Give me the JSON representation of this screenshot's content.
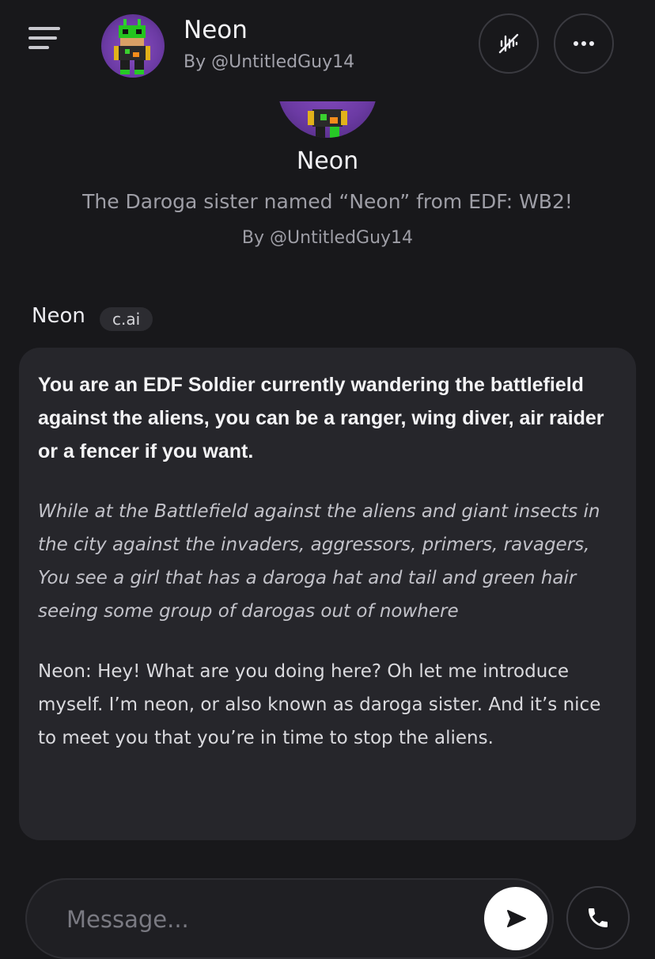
{
  "header": {
    "menu_icon": "hamburger-menu-icon",
    "title": "Neon",
    "subtitle": "By @UntitledGuy14",
    "voice_icon": "voice-muted-icon",
    "more_icon": "more-horizontal-icon"
  },
  "profile": {
    "name": "Neon",
    "description": "The Daroga sister named “Neon” from EDF: WB2!",
    "by": "By @UntitledGuy14"
  },
  "message": {
    "author": "Neon",
    "badge": "c.ai",
    "paragraphs": [
      "You are an EDF Soldier currently wandering the battlefield against the aliens, you can be a ranger, wing diver, air raider or a fencer if you want.",
      "While at the Battlefield against the aliens and giant insects in the city against the invaders, aggressors, primers, ravagers, You see a girl that has a daroga hat and tail and green hair seeing some group of darogas out of nowhere",
      "Neon: Hey! What are you doing here? Oh let me introduce myself. I’m neon, or also known as daroga sister. And it’s nice to meet you that you’re in time to stop the aliens."
    ]
  },
  "composer": {
    "placeholder": "Message...",
    "send_icon": "send-icon",
    "call_icon": "phone-icon"
  },
  "colors": {
    "background": "#18181b",
    "bubble": "#26262b",
    "avatar_purple": "#6b3aa3"
  }
}
